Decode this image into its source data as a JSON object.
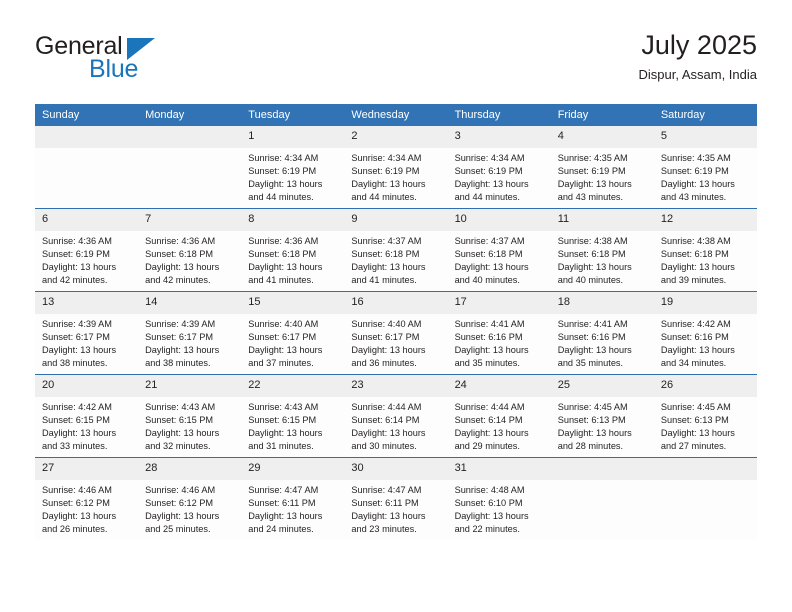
{
  "logo": {
    "word_top": "General",
    "word_bottom": "Blue",
    "triangle_icon": "blue-triangle-icon",
    "color_dark": "#231f20",
    "color_blue": "#1b75bb"
  },
  "header": {
    "title": "July 2025",
    "subtitle": "Dispur, Assam, India"
  },
  "theme": {
    "header_blue": "#3173b4",
    "row_separator": "#2f6fae",
    "daynum_band": "#efefef",
    "cell_background": "#fdfdfd",
    "text": "#231f20"
  },
  "calendar": {
    "weekday_headers": [
      "Sunday",
      "Monday",
      "Tuesday",
      "Wednesday",
      "Thursday",
      "Friday",
      "Saturday"
    ],
    "labels": {
      "sunrise": "Sunrise:",
      "sunset": "Sunset:",
      "daylight": "Daylight:"
    },
    "weeks": [
      [
        {
          "day": "",
          "empty": true
        },
        {
          "day": "",
          "empty": true
        },
        {
          "day": "1",
          "sunrise": "Sunrise: 4:34 AM",
          "sunset": "Sunset: 6:19 PM",
          "daylight": "Daylight: 13 hours and 44 minutes."
        },
        {
          "day": "2",
          "sunrise": "Sunrise: 4:34 AM",
          "sunset": "Sunset: 6:19 PM",
          "daylight": "Daylight: 13 hours and 44 minutes."
        },
        {
          "day": "3",
          "sunrise": "Sunrise: 4:34 AM",
          "sunset": "Sunset: 6:19 PM",
          "daylight": "Daylight: 13 hours and 44 minutes."
        },
        {
          "day": "4",
          "sunrise": "Sunrise: 4:35 AM",
          "sunset": "Sunset: 6:19 PM",
          "daylight": "Daylight: 13 hours and 43 minutes."
        },
        {
          "day": "5",
          "sunrise": "Sunrise: 4:35 AM",
          "sunset": "Sunset: 6:19 PM",
          "daylight": "Daylight: 13 hours and 43 minutes."
        }
      ],
      [
        {
          "day": "6",
          "sunrise": "Sunrise: 4:36 AM",
          "sunset": "Sunset: 6:19 PM",
          "daylight": "Daylight: 13 hours and 42 minutes."
        },
        {
          "day": "7",
          "sunrise": "Sunrise: 4:36 AM",
          "sunset": "Sunset: 6:18 PM",
          "daylight": "Daylight: 13 hours and 42 minutes."
        },
        {
          "day": "8",
          "sunrise": "Sunrise: 4:36 AM",
          "sunset": "Sunset: 6:18 PM",
          "daylight": "Daylight: 13 hours and 41 minutes."
        },
        {
          "day": "9",
          "sunrise": "Sunrise: 4:37 AM",
          "sunset": "Sunset: 6:18 PM",
          "daylight": "Daylight: 13 hours and 41 minutes."
        },
        {
          "day": "10",
          "sunrise": "Sunrise: 4:37 AM",
          "sunset": "Sunset: 6:18 PM",
          "daylight": "Daylight: 13 hours and 40 minutes."
        },
        {
          "day": "11",
          "sunrise": "Sunrise: 4:38 AM",
          "sunset": "Sunset: 6:18 PM",
          "daylight": "Daylight: 13 hours and 40 minutes."
        },
        {
          "day": "12",
          "sunrise": "Sunrise: 4:38 AM",
          "sunset": "Sunset: 6:18 PM",
          "daylight": "Daylight: 13 hours and 39 minutes."
        }
      ],
      [
        {
          "day": "13",
          "sunrise": "Sunrise: 4:39 AM",
          "sunset": "Sunset: 6:17 PM",
          "daylight": "Daylight: 13 hours and 38 minutes."
        },
        {
          "day": "14",
          "sunrise": "Sunrise: 4:39 AM",
          "sunset": "Sunset: 6:17 PM",
          "daylight": "Daylight: 13 hours and 38 minutes."
        },
        {
          "day": "15",
          "sunrise": "Sunrise: 4:40 AM",
          "sunset": "Sunset: 6:17 PM",
          "daylight": "Daylight: 13 hours and 37 minutes."
        },
        {
          "day": "16",
          "sunrise": "Sunrise: 4:40 AM",
          "sunset": "Sunset: 6:17 PM",
          "daylight": "Daylight: 13 hours and 36 minutes."
        },
        {
          "day": "17",
          "sunrise": "Sunrise: 4:41 AM",
          "sunset": "Sunset: 6:16 PM",
          "daylight": "Daylight: 13 hours and 35 minutes."
        },
        {
          "day": "18",
          "sunrise": "Sunrise: 4:41 AM",
          "sunset": "Sunset: 6:16 PM",
          "daylight": "Daylight: 13 hours and 35 minutes."
        },
        {
          "day": "19",
          "sunrise": "Sunrise: 4:42 AM",
          "sunset": "Sunset: 6:16 PM",
          "daylight": "Daylight: 13 hours and 34 minutes."
        }
      ],
      [
        {
          "day": "20",
          "sunrise": "Sunrise: 4:42 AM",
          "sunset": "Sunset: 6:15 PM",
          "daylight": "Daylight: 13 hours and 33 minutes."
        },
        {
          "day": "21",
          "sunrise": "Sunrise: 4:43 AM",
          "sunset": "Sunset: 6:15 PM",
          "daylight": "Daylight: 13 hours and 32 minutes."
        },
        {
          "day": "22",
          "sunrise": "Sunrise: 4:43 AM",
          "sunset": "Sunset: 6:15 PM",
          "daylight": "Daylight: 13 hours and 31 minutes."
        },
        {
          "day": "23",
          "sunrise": "Sunrise: 4:44 AM",
          "sunset": "Sunset: 6:14 PM",
          "daylight": "Daylight: 13 hours and 30 minutes."
        },
        {
          "day": "24",
          "sunrise": "Sunrise: 4:44 AM",
          "sunset": "Sunset: 6:14 PM",
          "daylight": "Daylight: 13 hours and 29 minutes."
        },
        {
          "day": "25",
          "sunrise": "Sunrise: 4:45 AM",
          "sunset": "Sunset: 6:13 PM",
          "daylight": "Daylight: 13 hours and 28 minutes."
        },
        {
          "day": "26",
          "sunrise": "Sunrise: 4:45 AM",
          "sunset": "Sunset: 6:13 PM",
          "daylight": "Daylight: 13 hours and 27 minutes."
        }
      ],
      [
        {
          "day": "27",
          "sunrise": "Sunrise: 4:46 AM",
          "sunset": "Sunset: 6:12 PM",
          "daylight": "Daylight: 13 hours and 26 minutes."
        },
        {
          "day": "28",
          "sunrise": "Sunrise: 4:46 AM",
          "sunset": "Sunset: 6:12 PM",
          "daylight": "Daylight: 13 hours and 25 minutes."
        },
        {
          "day": "29",
          "sunrise": "Sunrise: 4:47 AM",
          "sunset": "Sunset: 6:11 PM",
          "daylight": "Daylight: 13 hours and 24 minutes."
        },
        {
          "day": "30",
          "sunrise": "Sunrise: 4:47 AM",
          "sunset": "Sunset: 6:11 PM",
          "daylight": "Daylight: 13 hours and 23 minutes."
        },
        {
          "day": "31",
          "sunrise": "Sunrise: 4:48 AM",
          "sunset": "Sunset: 6:10 PM",
          "daylight": "Daylight: 13 hours and 22 minutes."
        },
        {
          "day": "",
          "empty": true
        },
        {
          "day": "",
          "empty": true
        }
      ]
    ]
  }
}
